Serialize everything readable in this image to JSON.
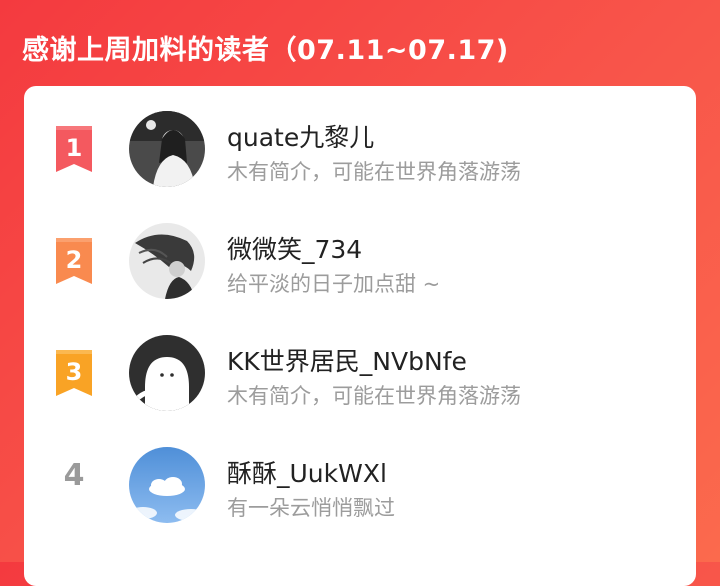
{
  "header": {
    "title": "感谢上周加料的读者（07.11~07.17)"
  },
  "colors": {
    "rank1": "#f4595f",
    "rank2": "#f98a4f",
    "rank3": "#f9a325",
    "rank_plain": "#9a9a9a",
    "background": "#f44a45"
  },
  "readers": [
    {
      "rank": "1",
      "name": "quate九黎儿",
      "bio": "木有简介，可能在世界角落游荡",
      "avatar": "avatar-photo-girl-icon"
    },
    {
      "rank": "2",
      "name": "微微笑_734",
      "bio": "给平淡的日子加点甜 ~",
      "avatar": "avatar-photo-hair-icon"
    },
    {
      "rank": "3",
      "name": "KK世界居民_NVbNfe",
      "bio": "木有简介，可能在世界角落游荡",
      "avatar": "avatar-default-ghost-icon"
    },
    {
      "rank": "4",
      "name": "酥酥_UukWXl",
      "bio": "有一朵云悄悄飘过",
      "avatar": "avatar-sky-cloud-icon"
    }
  ]
}
